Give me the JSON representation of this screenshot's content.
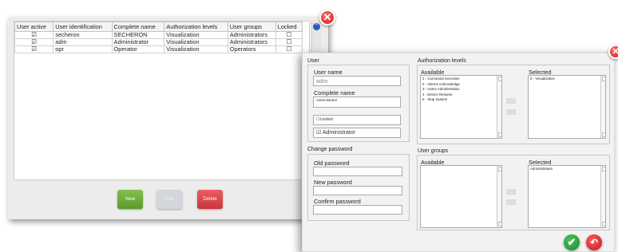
{
  "users_window": {
    "columns": [
      "User active",
      "User identification",
      "Complete name",
      "Authorization levels",
      "User groups",
      "Locked"
    ],
    "rows": [
      {
        "active": "☑",
        "id": "secheron",
        "name": "SECHERON",
        "auth": "Visualization",
        "group": "Administrators",
        "locked": "☐"
      },
      {
        "active": "☑",
        "id": "adm",
        "name": "Administrator",
        "auth": "Visualization",
        "group": "Administrators",
        "locked": "☐"
      },
      {
        "active": "☑",
        "id": "opr",
        "name": "Operator",
        "auth": "Visualization",
        "group": "Operators",
        "locked": "☐"
      }
    ],
    "scroll_glyph": "⌃",
    "close_glyph": "✕",
    "buttons": {
      "new": "New",
      "edit": "Edit",
      "delete": "Delete"
    }
  },
  "user_editor": {
    "close_glyph": "✕",
    "user_section": {
      "title": "User",
      "user_name_label": "User name",
      "user_name_value": "adm",
      "complete_name_label": "Complete name",
      "complete_name_value": "Administrator",
      "locked_label": "☐Locked",
      "administrator_label": "☑ Administrator"
    },
    "password_section": {
      "title": "Change password",
      "old_label": "Old password",
      "new_label": "New password",
      "confirm_label": "Confirm password"
    },
    "auth_section": {
      "title": "Authorization levels",
      "available_label": "Available",
      "selected_label": "Selected",
      "available_items": [
        "1 - Command execution",
        "2 - Alarms Acknowledge",
        "3 - Users Administration",
        "4 - Device Rename",
        "5 - Stop System"
      ],
      "selected_items": [
        "0 - Visualization"
      ],
      "move_right": "--->",
      "move_left": "<---"
    },
    "groups_section": {
      "title": "User groups",
      "available_label": "Available",
      "selected_label": "Selected",
      "available_items": [],
      "selected_items": [
        "Administrators"
      ],
      "move_right": "--->",
      "move_left": "<---"
    },
    "ok_glyph": "✔",
    "undo_glyph": "↶"
  },
  "colors": {
    "close": "#e02424",
    "new": "#6aa93a",
    "delete": "#d9434a",
    "ok": "#27a13a"
  }
}
